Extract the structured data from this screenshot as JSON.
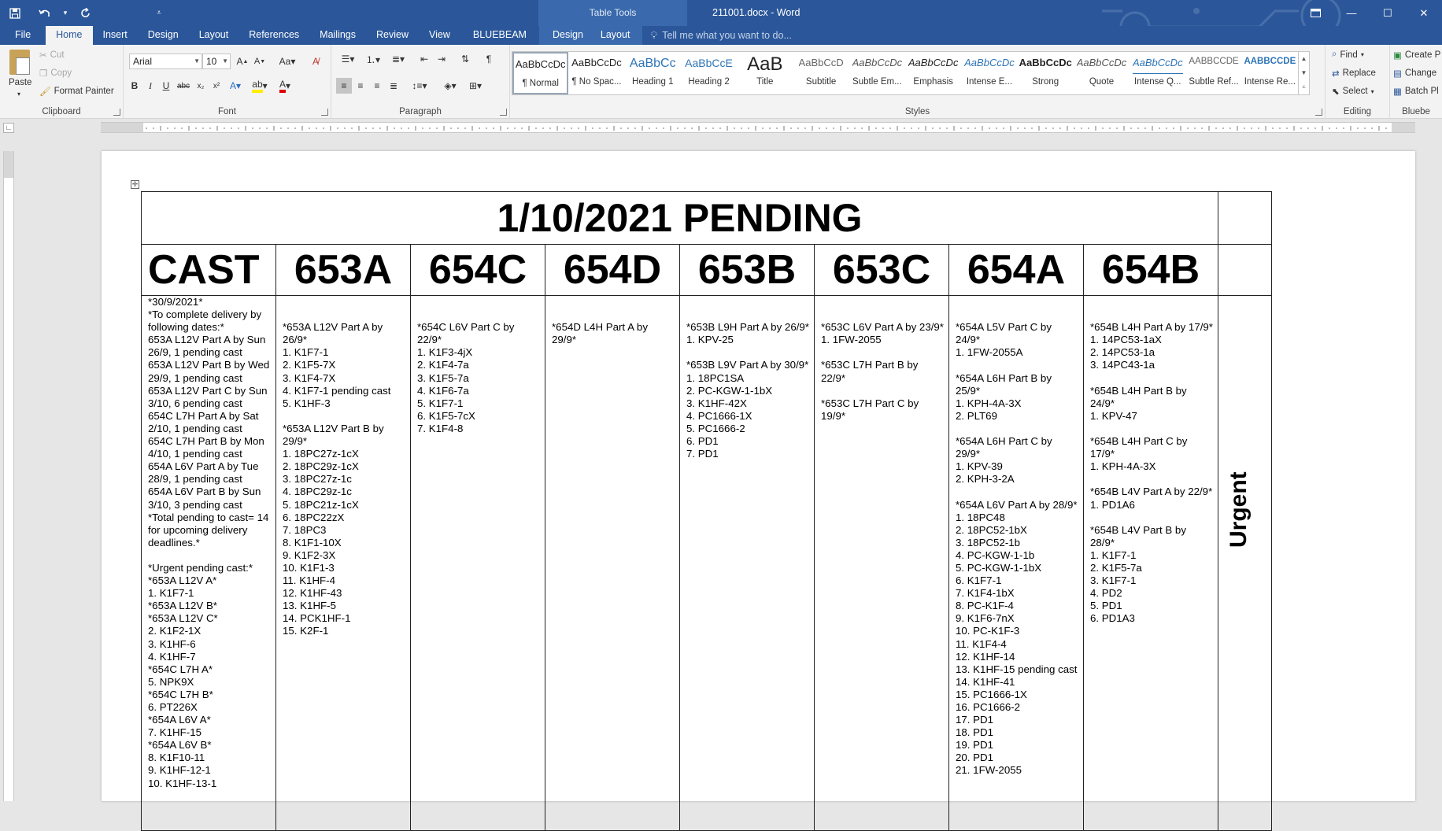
{
  "titlebar": {
    "doc_title": "211001.docx - Word",
    "context_tab": "Table Tools"
  },
  "tabs": [
    "File",
    "Home",
    "Insert",
    "Design",
    "Layout",
    "References",
    "Mailings",
    "Review",
    "View",
    "BLUEBEAM"
  ],
  "context_tabs": [
    "Design",
    "Layout"
  ],
  "tell_me": "Tell me what you want to do...",
  "ribbon": {
    "clipboard": {
      "paste": "Paste",
      "cut": "Cut",
      "copy": "Copy",
      "format_painter": "Format Painter",
      "label": "Clipboard"
    },
    "font": {
      "family": "Arial",
      "size": "10",
      "label": "Font"
    },
    "paragraph": {
      "label": "Paragraph"
    },
    "styles": {
      "label": "Styles",
      "items": [
        {
          "preview": "AaBbCcDc",
          "name": "¶ Normal"
        },
        {
          "preview": "AaBbCcDc",
          "name": "¶ No Spac..."
        },
        {
          "preview": "AaBbCc",
          "name": "Heading 1"
        },
        {
          "preview": "AaBbCcE",
          "name": "Heading 2"
        },
        {
          "preview": "AaB",
          "name": "Title"
        },
        {
          "preview": "AaBbCcD",
          "name": "Subtitle"
        },
        {
          "preview": "AaBbCcDc",
          "name": "Subtle Em..."
        },
        {
          "preview": "AaBbCcDc",
          "name": "Emphasis"
        },
        {
          "preview": "AaBbCcDc",
          "name": "Intense E..."
        },
        {
          "preview": "AaBbCcDc",
          "name": "Strong"
        },
        {
          "preview": "AaBbCcDc",
          "name": "Quote"
        },
        {
          "preview": "AaBbCcDc",
          "name": "Intense Q..."
        },
        {
          "preview": "AABBCCDE",
          "name": "Subtle Ref..."
        },
        {
          "preview": "AABBCCDE",
          "name": "Intense Re..."
        }
      ]
    },
    "editing": {
      "find": "Find",
      "replace": "Replace",
      "select": "Select",
      "label": "Editing"
    },
    "bluebeam": {
      "create": "Create P",
      "change": "Change",
      "batch": "Batch Pl",
      "label": "Bluebe"
    }
  },
  "document": {
    "title": "1/10/2021 PENDING",
    "headers": [
      "CAST",
      "653A",
      "654C",
      "654D",
      "653B",
      "653C",
      "654A",
      "654B"
    ],
    "urgent": "Urgent",
    "columns": [
      [
        "*30/9/2021*",
        "*To complete delivery by following dates:*",
        "653A L12V Part A by Sun 26/9, 1 pending cast",
        "653A L12V Part B by Wed 29/9, 1 pending cast",
        "653A L12V Part C by Sun 3/10, 6 pending cast",
        "654C L7H Part A by Sat 2/10, 1 pending cast",
        "654C L7H Part B by Mon 4/10, 1 pending cast",
        "654A L6V Part A by Tue 28/9, 1 pending cast",
        "654A L6V Part B by Sun 3/10, 3 pending cast",
        "*Total pending to cast= 14 for upcoming delivery deadlines.*",
        "",
        "*Urgent pending cast:*",
        "*653A L12V A*",
        "1. K1F7-1",
        "*653A L12V B*",
        "*653A L12V C*",
        "2. K1F2-1X",
        "3. K1HF-6",
        "4. K1HF-7",
        "*654C L7H A*",
        "5. NPK9X",
        "*654C L7H B*",
        "6. PT226X",
        "*654A L6V A*",
        "7. K1HF-15",
        "*654A L6V B*",
        "8. K1F10-11",
        "9. K1HF-12-1",
        "10. K1HF-13-1"
      ],
      [
        "",
        "",
        "*653A L12V Part A by 26/9*",
        "1. K1F7-1",
        "2. K1F5-7X",
        "3. K1F4-7X",
        "4. K1F7-1 pending cast",
        "5. K1HF-3",
        "",
        "*653A L12V Part B by 29/9*",
        "1. 18PC27z-1cX",
        "2. 18PC29z-1cX",
        "3. 18PC27z-1c",
        "4. 18PC29z-1c",
        "5. 18PC21z-1cX",
        "6. 18PC22zX",
        "7. 18PC3",
        "8. K1F1-10X",
        "9. K1F2-3X",
        "10. K1F1-3",
        "11. K1HF-4",
        "12. K1HF-43",
        "13. K1HF-5",
        "14. PCK1HF-1",
        "15. K2F-1"
      ],
      [
        "",
        "",
        "*654C L6V Part C by 22/9*",
        "1. K1F3-4jX",
        "2. K1F4-7a",
        "3. K1F5-7a",
        "4. K1F6-7a",
        "5. K1F7-1",
        "6. K1F5-7cX",
        "7. K1F4-8"
      ],
      [
        "",
        "",
        "*654D L4H Part A by 29/9*"
      ],
      [
        "",
        "",
        "*653B L9H Part A by 26/9*",
        "1. KPV-25",
        "",
        "*653B L9V Part A by 30/9*",
        "1. 18PC1SA",
        "2. PC-KGW-1-1bX",
        "3. K1HF-42X",
        "4. PC1666-1X",
        "5. PC1666-2",
        "6. PD1",
        "7. PD1"
      ],
      [
        "",
        "",
        "*653C L6V Part A by 23/9*",
        "1. 1FW-2055",
        "",
        "*653C L7H Part B by 22/9*",
        "",
        "*653C L7H Part C by 19/9*"
      ],
      [
        "",
        "",
        "*654A L5V Part C by 24/9*",
        "1. 1FW-2055A",
        "",
        "*654A L6H Part B by 25/9*",
        "1. KPH-4A-3X",
        "2. PLT69",
        "",
        "*654A L6H Part C by 29/9*",
        "1. KPV-39",
        "2. KPH-3-2A",
        "",
        "*654A L6V Part A by 28/9*",
        "1. 18PC48",
        "2. 18PC52-1bX",
        "3. 18PC52-1b",
        "4. PC-KGW-1-1b",
        "5. PC-KGW-1-1bX",
        "6. K1F7-1",
        "7. K1F4-1bX",
        "8. PC-K1F-4",
        "9. K1F6-7nX",
        "10. PC-K1F-3",
        "11. K1F4-4",
        "12. K1HF-14",
        "13. K1HF-15 pending cast",
        "14. K1HF-41",
        "15. PC1666-1X",
        "16. PC1666-2",
        "17. PD1",
        "18. PD1",
        "19. PD1",
        "20. PD1",
        "21. 1FW-2055"
      ],
      [
        "",
        "",
        "*654B L4H Part A by 17/9*",
        "1. 14PC53-1aX",
        "2. 14PC53-1a",
        "3. 14PC43-1a",
        "",
        "*654B L4H Part B by 24/9*",
        "1. KPV-47",
        "",
        "*654B L4H Part C by 17/9*",
        "1. KPH-4A-3X",
        "",
        "*654B L4V Part A by 22/9*",
        "1. PD1A6",
        "",
        "*654B L4V Part B by 28/9*",
        "1. K1F7-1",
        "2. K1F5-7a",
        "3. K1F7-1",
        "4. PD2",
        "5. PD1",
        "6. PD1A3"
      ]
    ]
  },
  "colors": {
    "word_blue": "#2b579a",
    "ribbon_bg": "#f3f3f3"
  }
}
